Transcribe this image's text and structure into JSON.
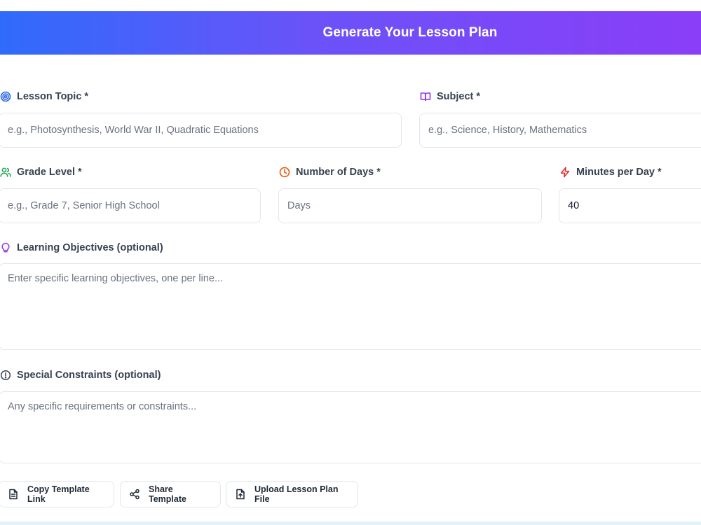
{
  "header": {
    "title": "Generate Your Lesson Plan"
  },
  "form": {
    "lesson_topic": {
      "label": "Lesson Topic *",
      "placeholder": "e.g., Photosynthesis, World War II, Quadratic Equations",
      "value": ""
    },
    "subject": {
      "label": "Subject *",
      "placeholder": "e.g., Science, History, Mathematics",
      "value": ""
    },
    "grade_level": {
      "label": "Grade Level *",
      "placeholder": "e.g., Grade 7, Senior High School",
      "value": ""
    },
    "number_of_days": {
      "label": "Number of Days *",
      "placeholder": "Days",
      "value": ""
    },
    "minutes_per_day": {
      "label": "Minutes per Day *",
      "placeholder": "",
      "value": "40"
    },
    "learning_objectives": {
      "label": "Learning Objectives (optional)",
      "placeholder": "Enter specific learning objectives, one per line...",
      "value": ""
    },
    "special_constraints": {
      "label": "Special Constraints (optional)",
      "placeholder": "Any specific requirements or constraints...",
      "value": ""
    }
  },
  "actions": {
    "copy_template_link": "Copy Template Link",
    "share_template": "Share Template",
    "upload_lesson_plan_file": "Upload Lesson Plan File"
  },
  "colors": {
    "header_gradient_start": "#2f6bfb",
    "header_gradient_end": "#8a3ef7",
    "topic_icon": "#2563eb",
    "subject_icon": "#9333ea",
    "grade_icon": "#16a34a",
    "days_icon": "#ea580c",
    "minutes_icon": "#dc2626",
    "objectives_icon": "#9333ea",
    "constraints_icon": "#374151"
  }
}
